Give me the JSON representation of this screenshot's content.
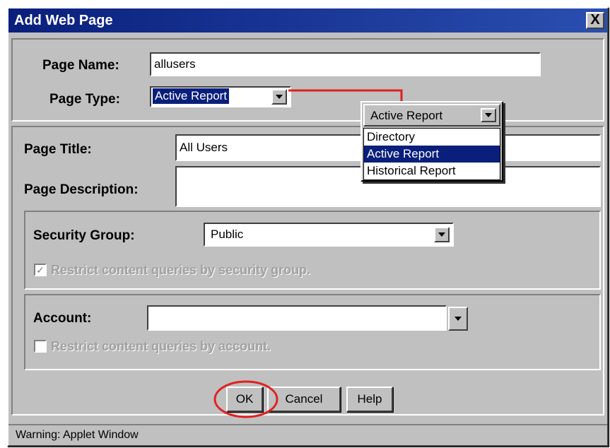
{
  "window": {
    "title": "Add Web Page",
    "close_label": "X"
  },
  "page_name": {
    "label": "Page Name:",
    "value": "allusers"
  },
  "page_type": {
    "label": "Page Type:",
    "selected": "Active Report"
  },
  "page_type_callout": {
    "selected": "Active Report",
    "options": [
      "Directory",
      "Active Report",
      "Historical Report"
    ]
  },
  "page_title": {
    "label": "Page Title:",
    "value": "All Users"
  },
  "page_description": {
    "label": "Page Description:",
    "value": ""
  },
  "security_group": {
    "label": "Security Group:",
    "selected": "Public",
    "restrict_label": "Restrict content queries by security group.",
    "restrict_checked": true
  },
  "account": {
    "label": "Account:",
    "selected": "",
    "restrict_label": "Restrict content queries by account.",
    "restrict_checked": false
  },
  "buttons": {
    "ok": "OK",
    "cancel": "Cancel",
    "help": "Help"
  },
  "status": {
    "text": "Warning: Applet Window"
  },
  "colors": {
    "title_bar": "#0a1f7c",
    "highlight": "#0a1f7c",
    "annotation": "#e02020"
  }
}
